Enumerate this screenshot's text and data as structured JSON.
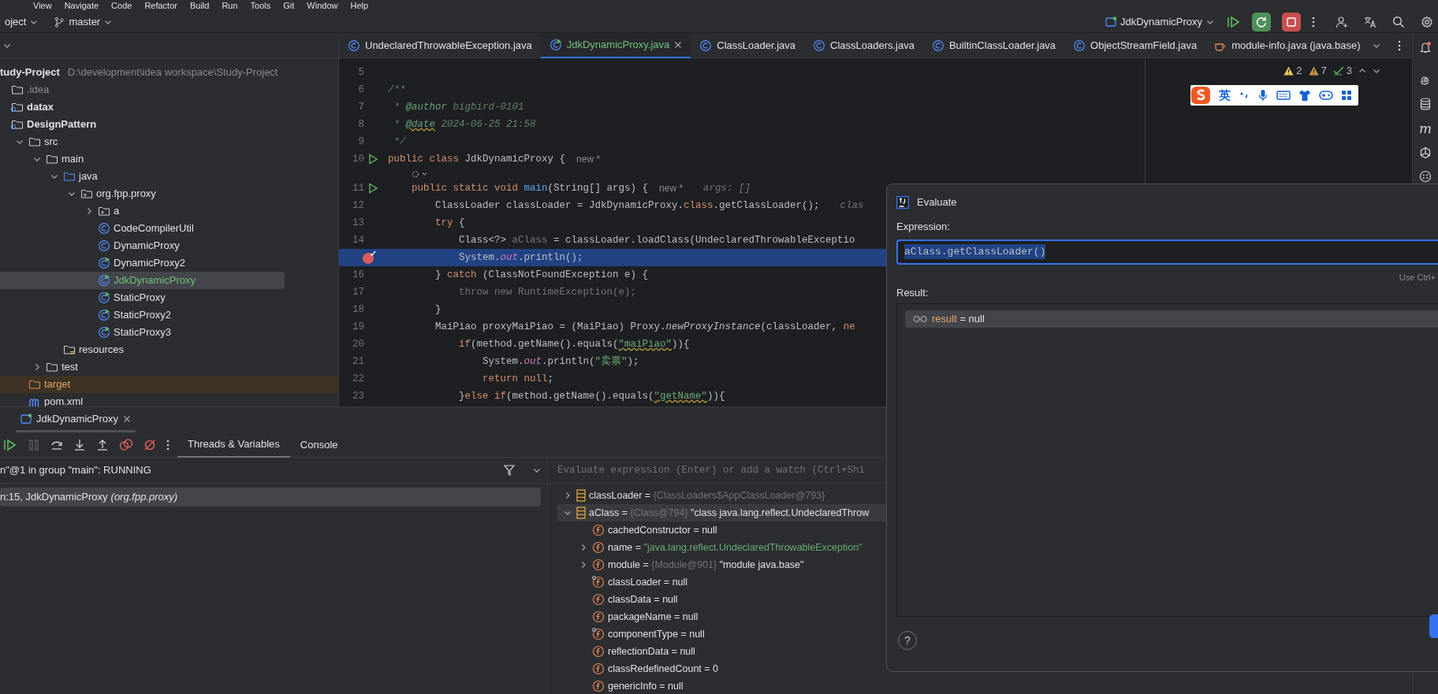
{
  "menu": [
    "View",
    "Navigate",
    "Code",
    "Refactor",
    "Build",
    "Run",
    "Tools",
    "Git",
    "Window",
    "Help"
  ],
  "toolbar": {
    "project": "oject",
    "branch": "master",
    "run_config": "JdkDynamicProxy"
  },
  "tool_strip": {
    "maven_label": "m"
  },
  "editor_tabs": [
    {
      "label": "UndeclaredThrowableException.java",
      "kind": "class",
      "selected": false
    },
    {
      "label": "JdkDynamicProxy.java",
      "kind": "runnable-class",
      "selected": true,
      "color": "#73bd79"
    },
    {
      "label": "ClassLoader.java",
      "kind": "class",
      "selected": false
    },
    {
      "label": "ClassLoaders.java",
      "kind": "class",
      "selected": false
    },
    {
      "label": "BuiltinClassLoader.java",
      "kind": "class",
      "selected": false
    },
    {
      "label": "ObjectStreamField.java",
      "kind": "class",
      "selected": false
    },
    {
      "label": "module-info.java (java.base)",
      "kind": "module-info",
      "selected": false
    }
  ],
  "project_tree": {
    "root": {
      "name": "tudy-Project",
      "path": "D:\\development\\idea workspace\\Study-Project"
    },
    "items": [
      {
        "name": ".idea",
        "kind": "config-folder",
        "selected": false
      },
      {
        "name": "datax",
        "kind": "module",
        "selected": false
      },
      {
        "name": "DesignPattern",
        "kind": "module",
        "selected": false,
        "children": [
          {
            "name": "src",
            "kind": "folder",
            "expanded": true,
            "selected": false,
            "children": [
              {
                "name": "main",
                "kind": "folder",
                "expanded": true,
                "selected": false,
                "children": [
                  {
                    "name": "java",
                    "kind": "source-root",
                    "expanded": true,
                    "selected": false,
                    "children": [
                      {
                        "name": "org.fpp.proxy",
                        "kind": "package",
                        "expanded": true,
                        "selected": false,
                        "children": [
                          {
                            "name": "a",
                            "kind": "package",
                            "expanded": false,
                            "selected": false
                          },
                          {
                            "name": "CodeCompilerUtil",
                            "kind": "class",
                            "selected": false
                          },
                          {
                            "name": "DynamicProxy",
                            "kind": "class",
                            "selected": false
                          },
                          {
                            "name": "DynamicProxy2",
                            "kind": "runnable-class",
                            "selected": false
                          },
                          {
                            "name": "JdkDynamicProxy",
                            "kind": "runnable-class",
                            "selected": true,
                            "color": "#73bd79"
                          },
                          {
                            "name": "StaticProxy",
                            "kind": "runnable-class",
                            "selected": false
                          },
                          {
                            "name": "StaticProxy2",
                            "kind": "runnable-class",
                            "selected": false
                          },
                          {
                            "name": "StaticProxy3",
                            "kind": "runnable-class",
                            "selected": false
                          }
                        ]
                      }
                    ]
                  },
                  {
                    "name": "resources",
                    "kind": "resources-root",
                    "selected": false
                  }
                ]
              },
              {
                "name": "test",
                "kind": "folder",
                "expanded": false,
                "selected": false
              }
            ]
          },
          {
            "name": "target",
            "kind": "excluded-folder",
            "selected": false
          },
          {
            "name": "pom.xml",
            "kind": "maven-file",
            "selected": false
          }
        ]
      }
    ]
  },
  "editor": {
    "inspections": [
      {
        "count": "2",
        "kind": "warning"
      },
      {
        "count": "7",
        "kind": "weak-warning"
      },
      {
        "count": "3",
        "kind": "typo"
      }
    ],
    "ime_bar": {
      "mode": "英"
    },
    "lines": [
      {
        "kind": "code",
        "number": "5",
        "current": false
      },
      {
        "kind": "code",
        "number": "6",
        "current": false,
        "tokens": [
          {
            "t": "/**",
            "kind": "doc"
          }
        ]
      },
      {
        "kind": "code",
        "number": "7",
        "current": false,
        "tokens": [
          {
            "t": " * ",
            "kind": "doc"
          },
          {
            "t": "@author",
            "kind": "doctag"
          },
          {
            "t": " bigbird-0101",
            "kind": "doc"
          }
        ]
      },
      {
        "kind": "code",
        "number": "8",
        "current": false,
        "tokens": [
          {
            "t": " * ",
            "kind": "doc"
          },
          {
            "t": "@date",
            "kind": "doctag-warn"
          },
          {
            "t": " 2024-06-25 21:58",
            "kind": "doc"
          }
        ]
      },
      {
        "kind": "code",
        "number": "9",
        "current": false,
        "tokens": [
          {
            "t": " */",
            "kind": "doc"
          }
        ]
      },
      {
        "kind": "code",
        "number": "10",
        "gutter": {
          "kind": "run"
        },
        "current": false,
        "tokens": [
          {
            "t": "public class ",
            "kind": "kw"
          },
          {
            "t": "JdkDynamicProxy {",
            "kind": "plain"
          }
        ],
        "hints": [
          {
            "text": "new *",
            "kind": "author"
          }
        ]
      },
      {
        "kind": "inlay"
      },
      {
        "kind": "code",
        "number": "11",
        "gutter": {
          "kind": "run"
        },
        "current": false,
        "tokens": [
          {
            "t": "    public static void ",
            "kind": "kw"
          },
          {
            "t": "main",
            "kind": "method"
          },
          {
            "t": "(String[] args) {",
            "kind": "plain"
          }
        ],
        "hints": [
          {
            "text": "new *",
            "kind": "author"
          },
          {
            "text": "args: []",
            "kind": "value"
          }
        ]
      },
      {
        "kind": "code",
        "number": "12",
        "current": false,
        "tokens": [
          {
            "t": "        ClassLoader classLoader = JdkDynamicProxy.",
            "kind": "plain"
          },
          {
            "t": "class",
            "kind": "kw"
          },
          {
            "t": ".getClassLoader();",
            "kind": "plain"
          }
        ],
        "hints": [
          {
            "text": "clas",
            "kind": "value"
          }
        ]
      },
      {
        "kind": "code",
        "number": "13",
        "current": false,
        "tokens": [
          {
            "t": "        try",
            "kind": "kw"
          },
          {
            "t": " {",
            "kind": "plain"
          }
        ]
      },
      {
        "kind": "code",
        "number": "14",
        "current": false,
        "tokens": [
          {
            "t": "            Class<?> ",
            "kind": "plain"
          },
          {
            "t": "aClass",
            "kind": "unused"
          },
          {
            "t": " = classLoader.loadClass(UndeclaredThrowableExceptio",
            "kind": "plain"
          }
        ]
      },
      {
        "kind": "code",
        "gutter": {
          "kind": "breakpoint"
        },
        "current": true,
        "tokens": [
          {
            "t": "            System.",
            "kind": "plain"
          },
          {
            "t": "out",
            "kind": "static"
          },
          {
            "t": ".println();",
            "kind": "plain"
          }
        ]
      },
      {
        "kind": "code",
        "number": "16",
        "current": false,
        "tokens": [
          {
            "t": "        } ",
            "kind": "plain"
          },
          {
            "t": "catch",
            "kind": "kw"
          },
          {
            "t": " (ClassNotFoundException e) {",
            "kind": "plain"
          }
        ]
      },
      {
        "kind": "code",
        "number": "17",
        "current": false,
        "tokens": [
          {
            "t": "            throw new RuntimeException(e);",
            "kind": "unused"
          }
        ]
      },
      {
        "kind": "code",
        "number": "18",
        "current": false,
        "tokens": [
          {
            "t": "        }",
            "kind": "plain"
          }
        ]
      },
      {
        "kind": "code",
        "number": "19",
        "current": false,
        "tokens": [
          {
            "t": "        MaiPiao proxyMaiPiao = (MaiPiao) Proxy.",
            "kind": "plain"
          },
          {
            "t": "newProxyInstance",
            "kind": "italic"
          },
          {
            "t": "(classLoader, ",
            "kind": "plain"
          },
          {
            "t": "ne",
            "kind": "kw"
          }
        ]
      },
      {
        "kind": "code",
        "number": "20",
        "current": false,
        "tokens": [
          {
            "t": "            if",
            "kind": "kw"
          },
          {
            "t": "(method.getName().equals(",
            "kind": "plain"
          },
          {
            "t": "\"maiPiao\"",
            "kind": "string-warn"
          },
          {
            "t": ")){",
            "kind": "plain"
          }
        ]
      },
      {
        "kind": "code",
        "number": "21",
        "current": false,
        "tokens": [
          {
            "t": "                System.",
            "kind": "plain"
          },
          {
            "t": "out",
            "kind": "static"
          },
          {
            "t": ".println(",
            "kind": "plain"
          },
          {
            "t": "\"卖票\"",
            "kind": "string"
          },
          {
            "t": ");",
            "kind": "plain"
          }
        ]
      },
      {
        "kind": "code",
        "number": "22",
        "current": false,
        "tokens": [
          {
            "t": "                return null",
            "kind": "kw"
          },
          {
            "t": ";",
            "kind": "plain"
          }
        ]
      },
      {
        "kind": "code",
        "number": "23",
        "current": false,
        "tokens": [
          {
            "t": "            }",
            "kind": "plain"
          },
          {
            "t": "else if",
            "kind": "kw"
          },
          {
            "t": "(method.getName().equals(",
            "kind": "plain"
          },
          {
            "t": "\"getName\"",
            "kind": "string-warn"
          },
          {
            "t": ")){",
            "kind": "plain"
          }
        ]
      }
    ]
  },
  "debug": {
    "session_tab": {
      "label": "JdkDynamicProxy"
    },
    "tabs": [
      {
        "label": "Threads & Variables",
        "selected": true
      },
      {
        "label": "Console",
        "selected": false
      }
    ],
    "thread": {
      "label": "n\"@1 in group \"main\": RUNNING"
    },
    "frames": [
      {
        "text": "n:15, JdkDynamicProxy",
        "package": "(org.fpp.proxy)",
        "selected": true
      }
    ],
    "watch": {
      "placeholder": "Evaluate expression (Enter) or add a watch (Ctrl+Shi"
    },
    "variables": [
      {
        "name": "classLoader",
        "op": "=",
        "kind": "local",
        "expanded": false,
        "selected": false,
        "ref": "{ClassLoaders$AppClassLoader@793}"
      },
      {
        "name": "aClass",
        "op": "=",
        "kind": "local",
        "expanded": true,
        "selected": true,
        "ref": "{Class@794}",
        "value": "\"class java.lang.reflect.UndeclaredThrow",
        "string_value": false,
        "children": [
          {
            "name": "cachedConstructor",
            "op": "=",
            "kind": "field",
            "selected": false,
            "value": "null",
            "string_value": false
          },
          {
            "name": "name",
            "op": "=",
            "kind": "field",
            "expanded": false,
            "selected": false,
            "value": "\"java.lang.reflect.UndeclaredThrowableException\"",
            "string_value": true
          },
          {
            "name": "module",
            "op": "=",
            "kind": "field",
            "expanded": false,
            "selected": false,
            "ref": "{Module@901}",
            "value": "\"module java.base\"",
            "string_value": false
          },
          {
            "name": "classLoader",
            "op": "=",
            "kind": "field-marked",
            "selected": false,
            "value": "null",
            "string_value": false
          },
          {
            "name": "classData",
            "op": "=",
            "kind": "field",
            "selected": false,
            "value": "null",
            "string_value": false
          },
          {
            "name": "packageName",
            "op": "=",
            "kind": "field",
            "selected": false,
            "value": "null",
            "string_value": false
          },
          {
            "name": "componentType",
            "op": "=",
            "kind": "field-marked",
            "selected": false,
            "value": "null",
            "string_value": false
          },
          {
            "name": "reflectionData",
            "op": "=",
            "kind": "field",
            "selected": false,
            "value": "null",
            "string_value": false
          },
          {
            "name": "classRedefinedCount",
            "op": "=",
            "kind": "field",
            "selected": false,
            "value": "0",
            "string_value": false
          },
          {
            "name": "genericInfo",
            "op": "=",
            "kind": "field",
            "selected": false,
            "value": "null",
            "string_value": false
          }
        ]
      }
    ]
  },
  "evaluate": {
    "title": "Evaluate",
    "expression_label": "Expression:",
    "expression": "aClass.getClassLoader()",
    "hint": "Use Ctrl+",
    "result_label": "Result:",
    "results": [
      {
        "name": "result",
        "op": "=",
        "value": "null",
        "selected": true
      }
    ],
    "help": "?"
  }
}
